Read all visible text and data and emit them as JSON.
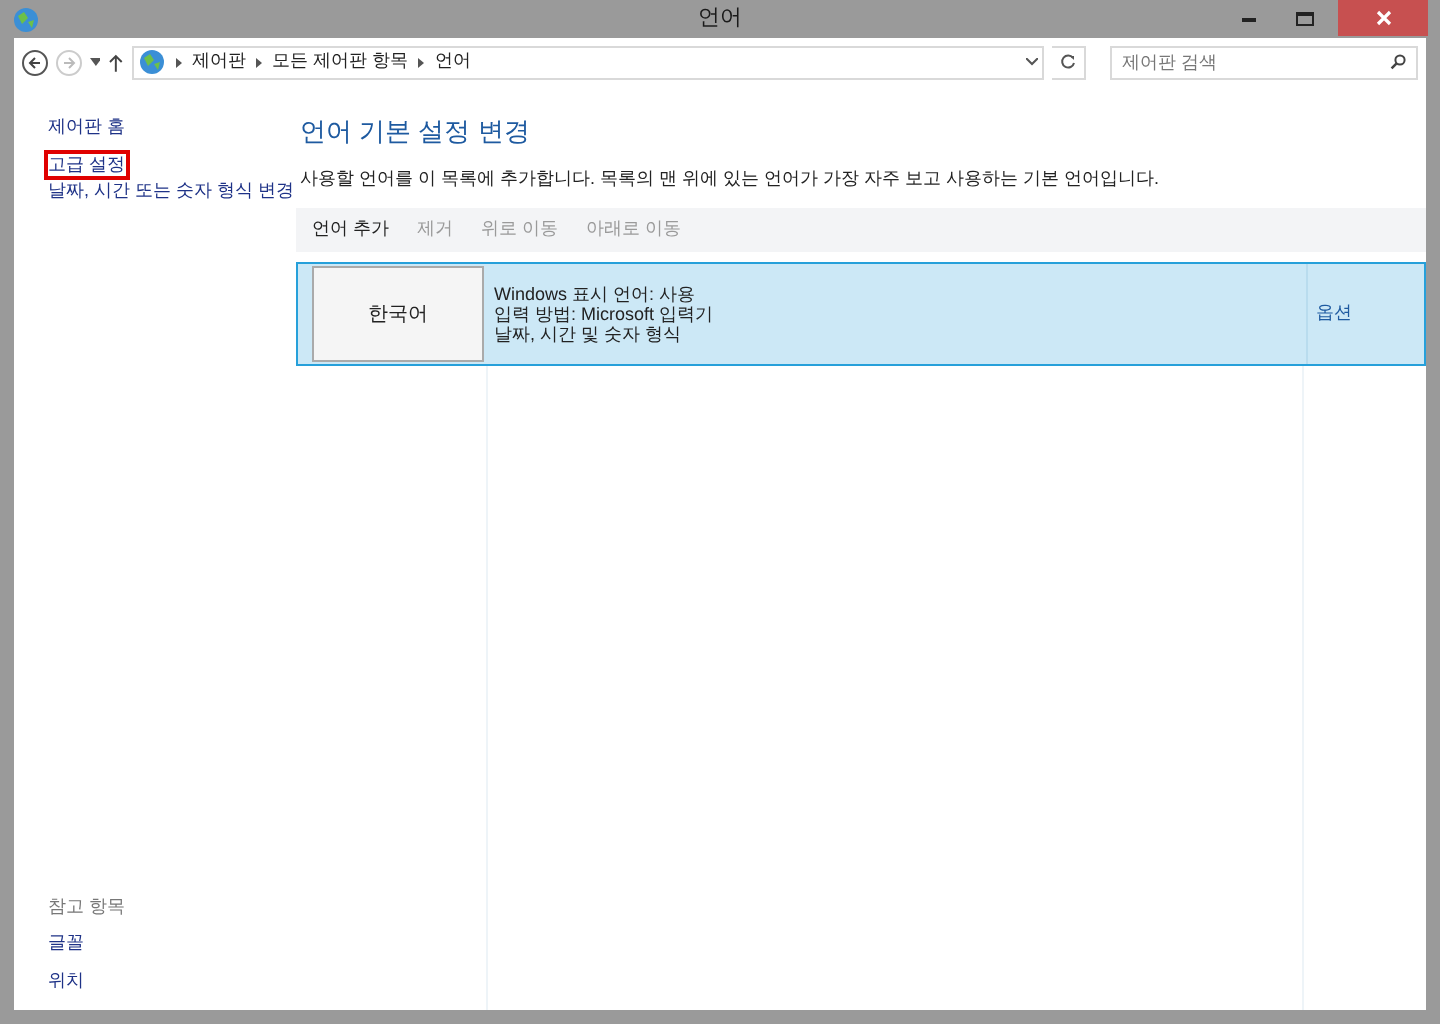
{
  "window": {
    "title": "언어"
  },
  "address_bar": {
    "path": [
      "제어판",
      "모든 제어판 항목",
      "언어"
    ]
  },
  "search": {
    "placeholder": "제어판 검색"
  },
  "sidebar": {
    "items": [
      {
        "label": "제어판 홈",
        "highlighted": false
      },
      {
        "label": "고급 설정",
        "highlighted": true
      },
      {
        "label": "날짜, 시간 또는 숫자 형식 변경",
        "highlighted": false
      }
    ],
    "see_also": {
      "heading": "참고 항목",
      "links": [
        "글꼴",
        "위치"
      ]
    }
  },
  "main": {
    "heading": "언어 기본 설정 변경",
    "description": "사용할 언어를 이 목록에 추가합니다. 목록의 맨 위에 있는 언어가 가장 자주 보고 사용하는 기본 언어입니다.",
    "toolbar": [
      {
        "label": "언어 추가",
        "disabled": false
      },
      {
        "label": "제거",
        "disabled": true
      },
      {
        "label": "위로 이동",
        "disabled": true
      },
      {
        "label": "아래로 이동",
        "disabled": true
      }
    ],
    "languages": [
      {
        "name": "한국어",
        "details": [
          "Windows 표시 언어: 사용",
          "입력 방법: Microsoft 입력기",
          "날짜, 시간 및 숫자 형식"
        ],
        "options": "옵션",
        "selected": true
      }
    ]
  }
}
